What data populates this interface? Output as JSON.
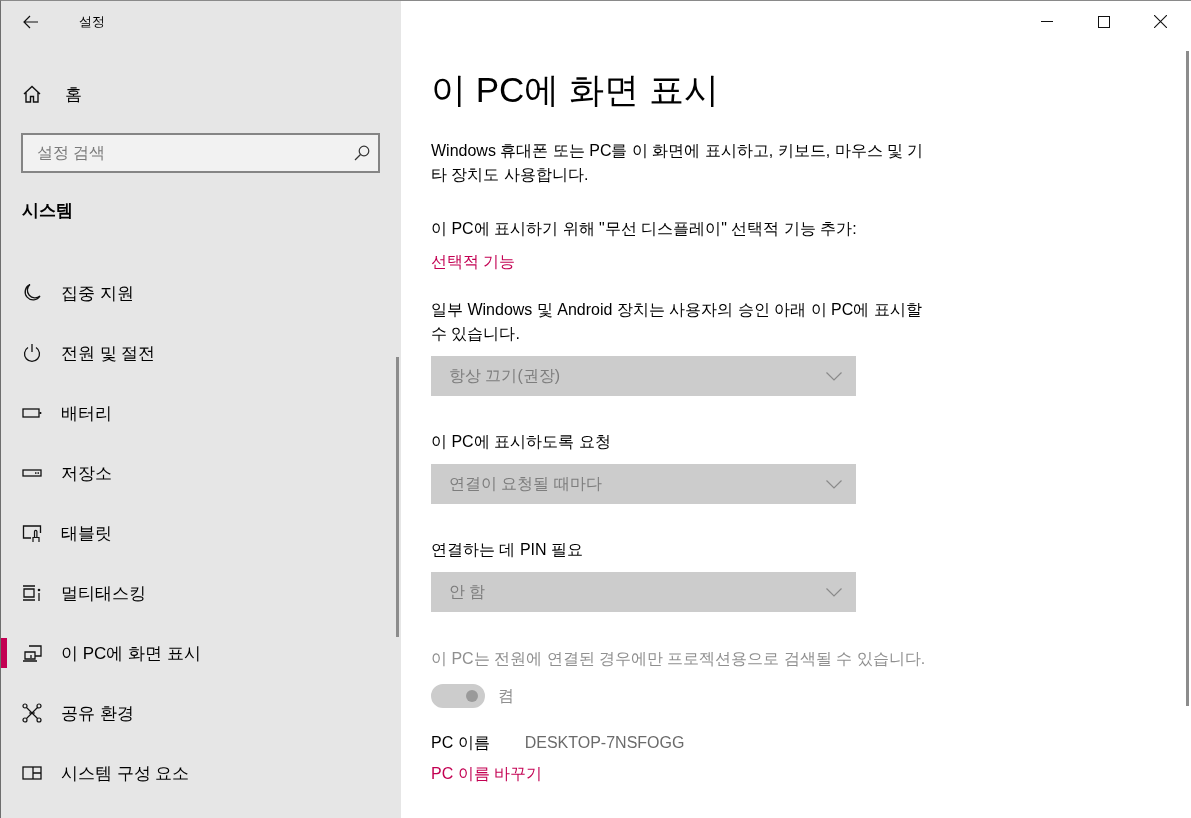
{
  "window": {
    "title": "설정"
  },
  "sidebar": {
    "home": "홈",
    "search": {
      "placeholder": "설정 검색"
    },
    "section": "시스템",
    "items": [
      {
        "label": "집중 지원",
        "selected": false
      },
      {
        "label": "전원 및 절전",
        "selected": false
      },
      {
        "label": "배터리",
        "selected": false
      },
      {
        "label": "저장소",
        "selected": false
      },
      {
        "label": "태블릿",
        "selected": false
      },
      {
        "label": "멀티태스킹",
        "selected": false
      },
      {
        "label": "이 PC에 화면 표시",
        "selected": true
      },
      {
        "label": "공유 환경",
        "selected": false
      },
      {
        "label": "시스템 구성 요소",
        "selected": false
      }
    ]
  },
  "page": {
    "title": "이 PC에 화면 표시",
    "description": "Windows 휴대폰 또는 PC를 이 화면에 표시하고, 키보드, 마우스 및 기타 장치도 사용합니다.",
    "feature_prompt": "이 PC에 표시하기 위해 \"무선 디스플레이\" 선택적 기능 추가:",
    "feature_link": "선택적 기능",
    "settings": [
      {
        "label": "일부 Windows 및 Android 장치는 사용자의 승인 아래 이 PC에 표시할 수 있습니다.",
        "value": "항상 끄기(권장)",
        "disabled": true
      },
      {
        "label": "이 PC에 표시하도록 요청",
        "value": "연결이 요청될 때마다",
        "disabled": true
      },
      {
        "label": "연결하는 데 PIN 필요",
        "value": "안 함",
        "disabled": true
      }
    ],
    "power_note": {
      "text": "이 PC는 전원에 연결된 경우에만 프로젝션용으로 검색될 수 있습니다.",
      "disabled": true
    },
    "power_toggle": {
      "label": "켬",
      "on": true,
      "disabled": true
    },
    "pc_name": {
      "label": "PC 이름",
      "value": "DESKTOP-7NSFOGG"
    },
    "rename_link": "PC 이름 바꾸기"
  }
}
